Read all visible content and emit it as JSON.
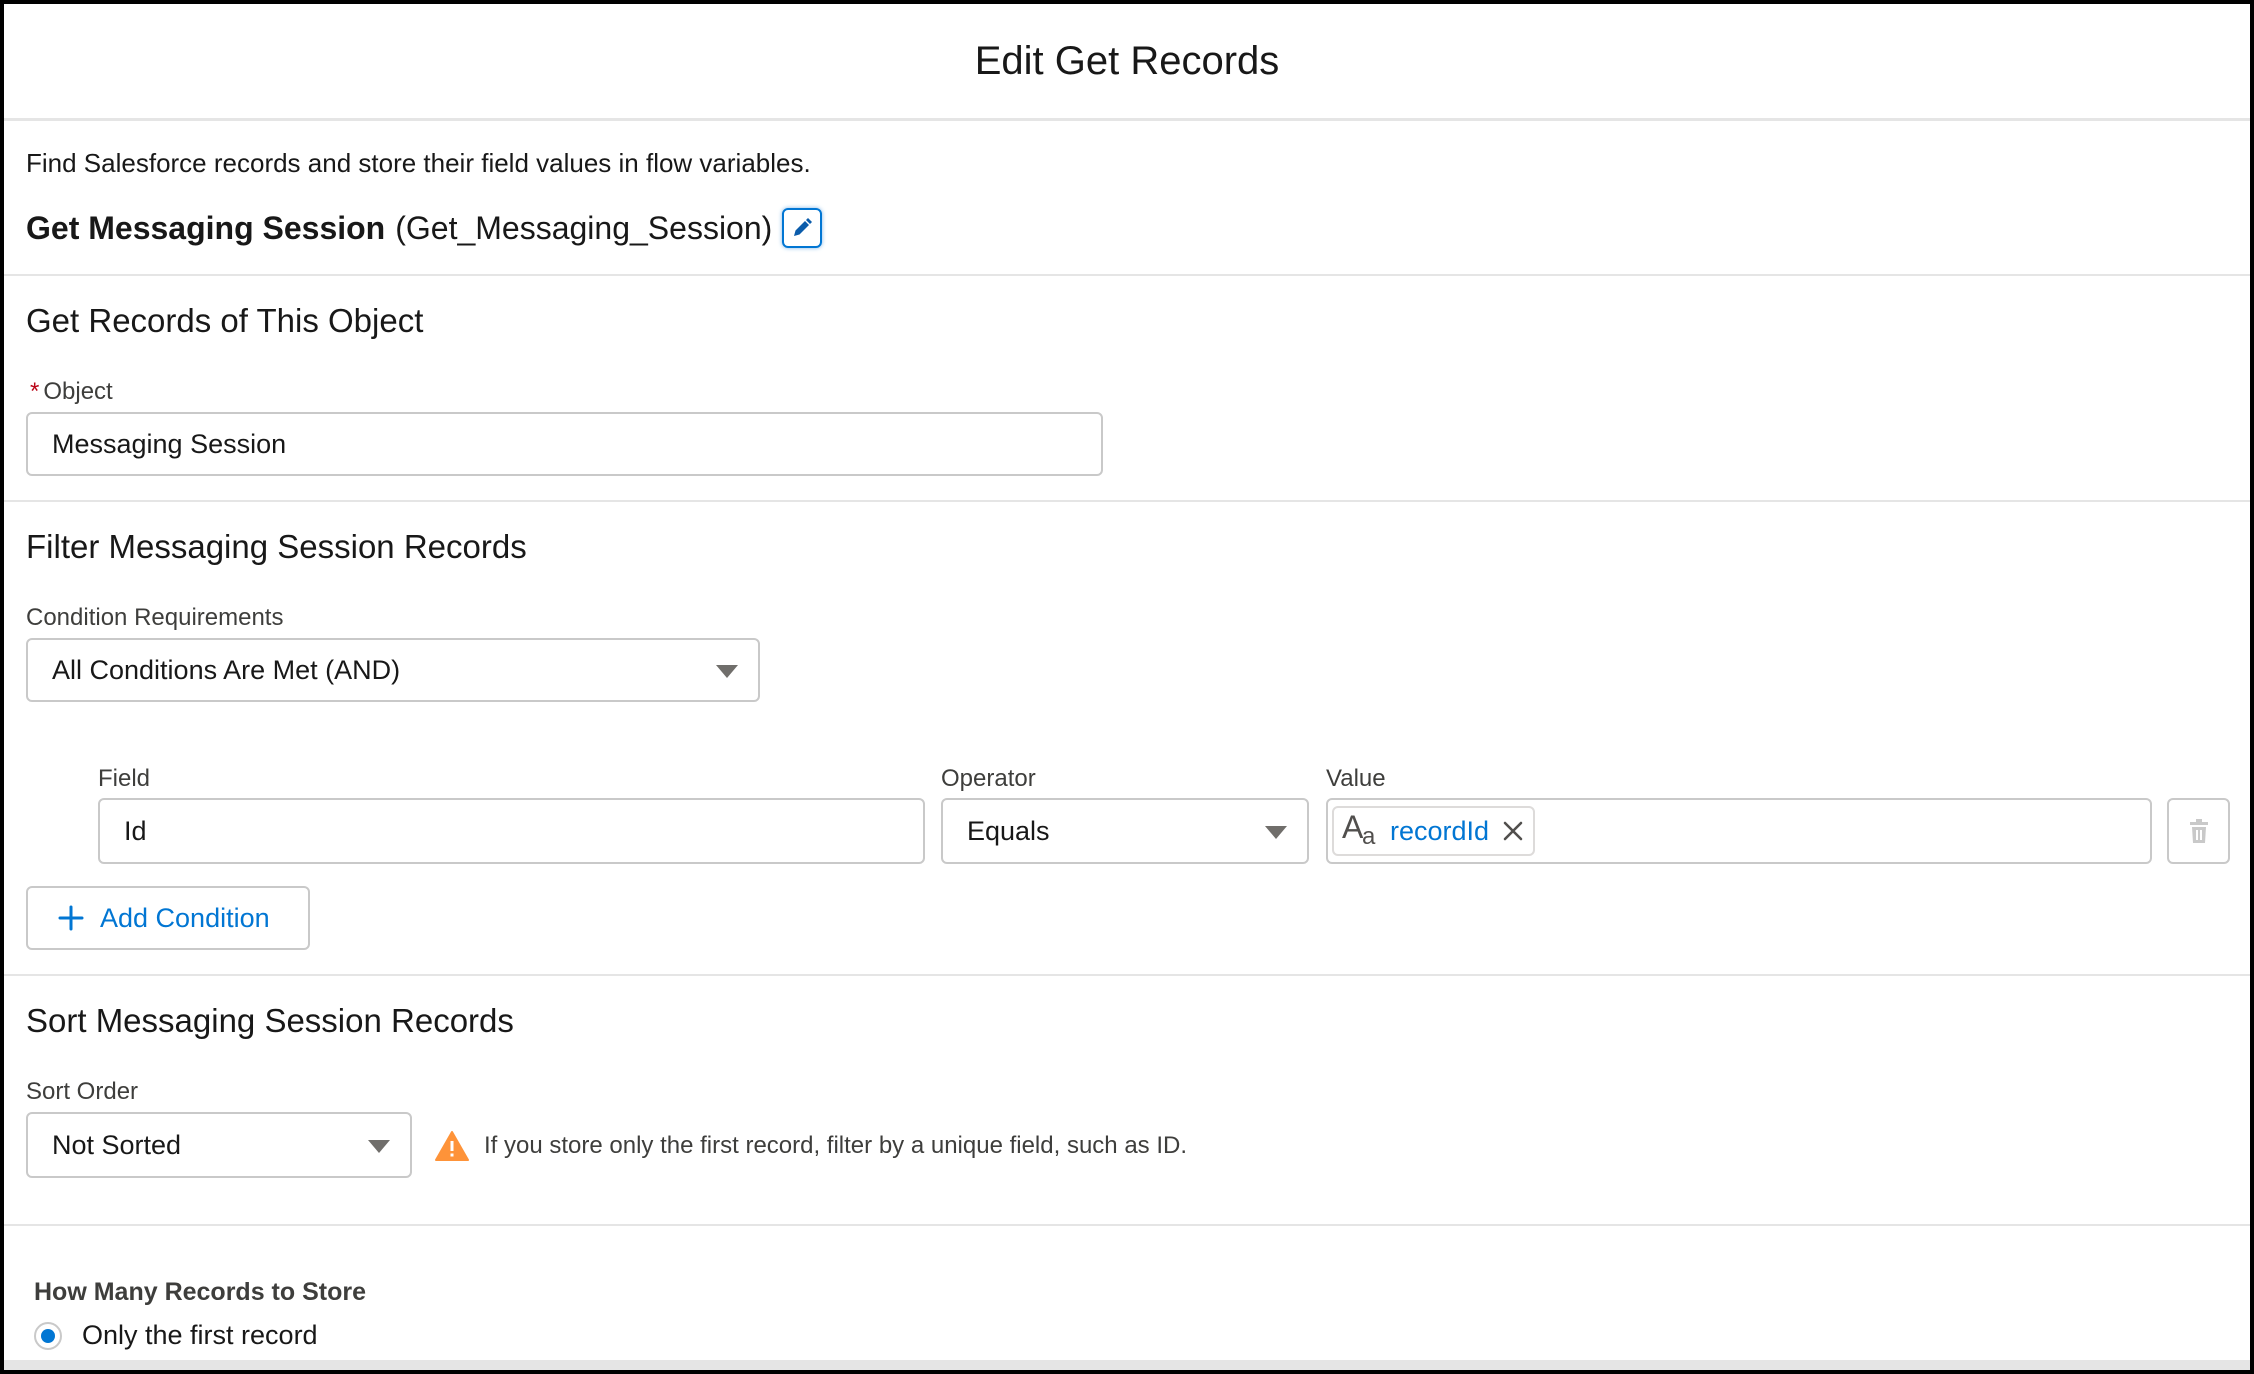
{
  "modal": {
    "title": "Edit Get Records"
  },
  "description": "Find Salesforce records and store their field values in flow variables.",
  "element": {
    "label": "Get Messaging Session",
    "api_name": "(Get_Messaging_Session)",
    "edit_icon": "pencil-icon"
  },
  "object_section": {
    "title": "Get Records of This Object",
    "required_marker": "*",
    "object_label": "Object",
    "object_value": "Messaging Session"
  },
  "filter_section": {
    "title": "Filter Messaging Session Records",
    "condition_label": "Condition Requirements",
    "condition_value": "All Conditions Are Met (AND)",
    "condition": {
      "field_label": "Field",
      "field_value": "Id",
      "operator_label": "Operator",
      "operator_value": "Equals",
      "value_label": "Value",
      "value_pill": "recordId",
      "value_type_icon": "text-type-icon",
      "delete_icon": "trash-icon"
    },
    "add_condition": "Add Condition"
  },
  "sort_section": {
    "title": "Sort Messaging Session Records",
    "sort_label": "Sort Order",
    "sort_value": "Not Sorted",
    "warning": "If you store only the first record, filter by a unique field, such as ID."
  },
  "store_section": {
    "title": "How Many Records to Store",
    "option_first": "Only the first record"
  },
  "colors": {
    "brand": "#0176d3",
    "warning": "#fe9339",
    "required": "#ba0517",
    "border": "#c9c9c9"
  }
}
